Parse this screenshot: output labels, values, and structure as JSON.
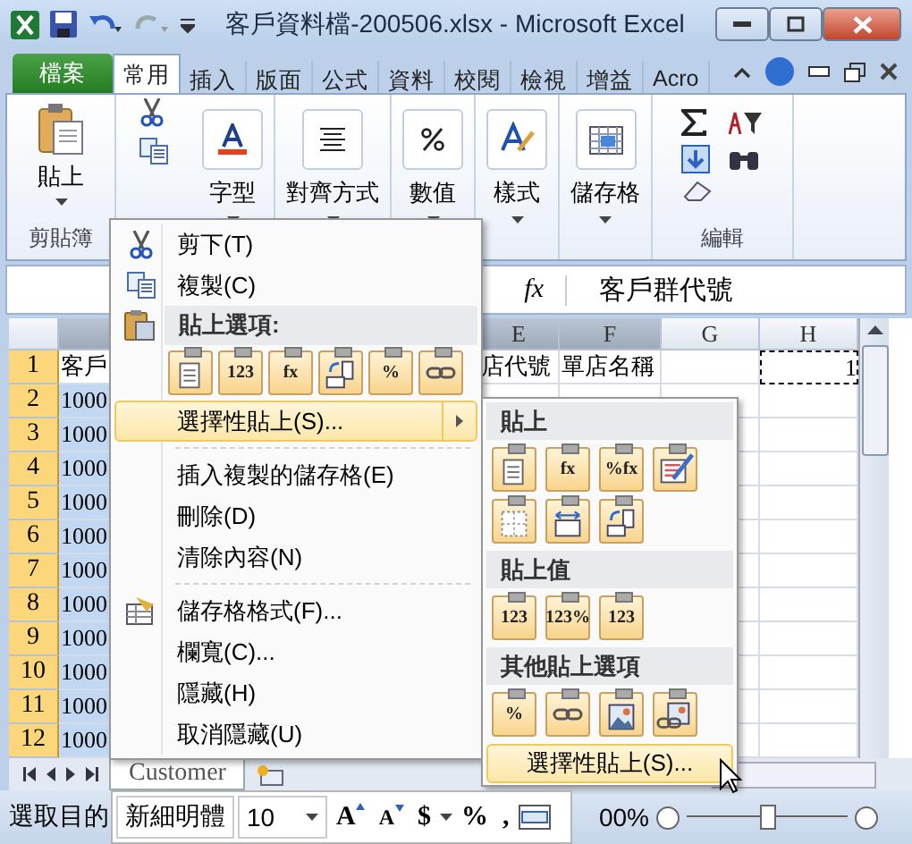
{
  "title_bar": {
    "title": "客戶資料檔-200506.xlsx  -  Microsoft Excel"
  },
  "ribbon_tabs": [
    {
      "label": "檔案",
      "kind": "file",
      "selected": false
    },
    {
      "label": "常用",
      "kind": "tab",
      "selected": true
    },
    {
      "label": "插入",
      "kind": "tab",
      "selected": false
    },
    {
      "label": "版面",
      "kind": "tab",
      "selected": false
    },
    {
      "label": "公式",
      "kind": "tab",
      "selected": false
    },
    {
      "label": "資料",
      "kind": "tab",
      "selected": false
    },
    {
      "label": "校閱",
      "kind": "tab",
      "selected": false
    },
    {
      "label": "檢視",
      "kind": "tab",
      "selected": false
    },
    {
      "label": "增益",
      "kind": "tab",
      "selected": false
    },
    {
      "label": "Acro",
      "kind": "tab",
      "selected": false
    }
  ],
  "clipboard_group": {
    "paste_label": "貼上",
    "label": "剪貼簿"
  },
  "collapsed_groups": [
    {
      "label": "字型",
      "kind": "font"
    },
    {
      "label": "對齊方式",
      "kind": "align"
    },
    {
      "label": "數值",
      "kind": "number"
    },
    {
      "label": "樣式",
      "kind": "styles"
    },
    {
      "label": "儲存格",
      "kind": "cells"
    }
  ],
  "editing_group": {
    "label": "編輯"
  },
  "formula_bar": {
    "function_label": "fx",
    "value": "客戶群代號"
  },
  "columns": [
    {
      "label": "E",
      "selected": true
    },
    {
      "label": "F",
      "selected": true
    },
    {
      "label": "G",
      "selected": false
    },
    {
      "label": "H",
      "selected": false
    }
  ],
  "rows": [
    {
      "header": "1",
      "selected": true,
      "cell_a": "客戶",
      "cell_e": "店代號",
      "cell_f": "單店名稱",
      "cell_h": "1",
      "cell_h_copied": true
    },
    {
      "header": "2",
      "selected": true,
      "cell_a": "1000"
    },
    {
      "header": "3",
      "selected": true,
      "cell_a": "1000"
    },
    {
      "header": "4",
      "selected": true,
      "cell_a": "1000"
    },
    {
      "header": "5",
      "selected": true,
      "cell_a": "1000"
    },
    {
      "header": "6",
      "selected": true,
      "cell_a": "1000"
    },
    {
      "header": "7",
      "selected": true,
      "cell_a": "1000"
    },
    {
      "header": "8",
      "selected": true,
      "cell_a": "1000"
    },
    {
      "header": "9",
      "selected": true,
      "cell_a": "1000"
    },
    {
      "header": "10",
      "selected": true,
      "cell_a": "1000"
    },
    {
      "header": "11",
      "selected": true,
      "cell_a": "1000"
    },
    {
      "header": "12",
      "selected": true,
      "cell_a": "1000"
    }
  ],
  "context_menu": {
    "items": [
      {
        "kind": "item",
        "label": "剪下(T)",
        "selected": false
      },
      {
        "kind": "item",
        "label": "複製(C)",
        "selected": false
      },
      {
        "kind": "header",
        "label": "貼上選項:"
      },
      {
        "kind": "icons",
        "icons": [
          {
            "kind": "document"
          },
          {
            "kind": "glyph",
            "glyph": "123"
          },
          {
            "kind": "glyph",
            "glyph": "fx"
          },
          {
            "kind": "transpose"
          },
          {
            "kind": "glyph",
            "glyph": "%"
          },
          {
            "kind": "link"
          }
        ]
      },
      {
        "kind": "item",
        "label": "選擇性貼上(S)...",
        "submenu": true,
        "selected": true
      },
      {
        "kind": "separator"
      },
      {
        "kind": "item",
        "label": "插入複製的儲存格(E)",
        "selected": false
      },
      {
        "kind": "item",
        "label": "刪除(D)",
        "selected": false
      },
      {
        "kind": "item",
        "label": "清除內容(N)",
        "selected": false
      },
      {
        "kind": "separator"
      },
      {
        "kind": "item",
        "label": "儲存格格式(F)...",
        "selected": false
      },
      {
        "kind": "item",
        "label": "欄寬(C)...",
        "selected": false
      },
      {
        "kind": "item",
        "label": "隱藏(H)",
        "selected": false
      },
      {
        "kind": "item",
        "label": "取消隱藏(U)",
        "selected": false
      }
    ]
  },
  "submenu": {
    "sections": [
      {
        "label": "貼上",
        "icons": [
          {
            "kind": "document"
          },
          {
            "kind": "glyph",
            "glyph": "fx"
          },
          {
            "kind": "glyph",
            "glyph": "%fx"
          },
          {
            "kind": "brush"
          },
          {
            "kind": "borders"
          },
          {
            "kind": "width"
          },
          {
            "kind": "transpose"
          }
        ]
      },
      {
        "label": "貼上值",
        "icons": [
          {
            "kind": "glyph",
            "glyph": "123"
          },
          {
            "kind": "glyph",
            "glyph": "123%"
          },
          {
            "kind": "glyph",
            "glyph": "123"
          }
        ]
      },
      {
        "label": "其他貼上選項",
        "icons": [
          {
            "kind": "glyph",
            "glyph": "%"
          },
          {
            "kind": "link"
          },
          {
            "kind": "picture"
          },
          {
            "kind": "linked-picture"
          }
        ]
      }
    ],
    "button": {
      "label": "選擇性貼上(S)...",
      "selected": true
    }
  },
  "sheet_tabs": [
    {
      "label": "Customer",
      "selected": true
    }
  ],
  "mini_toolbar": {
    "font": "新細明體",
    "size": "10",
    "buttons": [
      {
        "glyph": "A",
        "kind": "grow"
      },
      {
        "glyph": "A",
        "kind": "shrink"
      },
      {
        "glyph": "$",
        "kind": "currency"
      },
      {
        "glyph": "%",
        "kind": "plain"
      },
      {
        "glyph": ",",
        "kind": "plain"
      }
    ]
  },
  "status_bar": {
    "text": "選取目的",
    "zoom": "00%",
    "zoom_slider": {
      "level": 0.5
    }
  }
}
